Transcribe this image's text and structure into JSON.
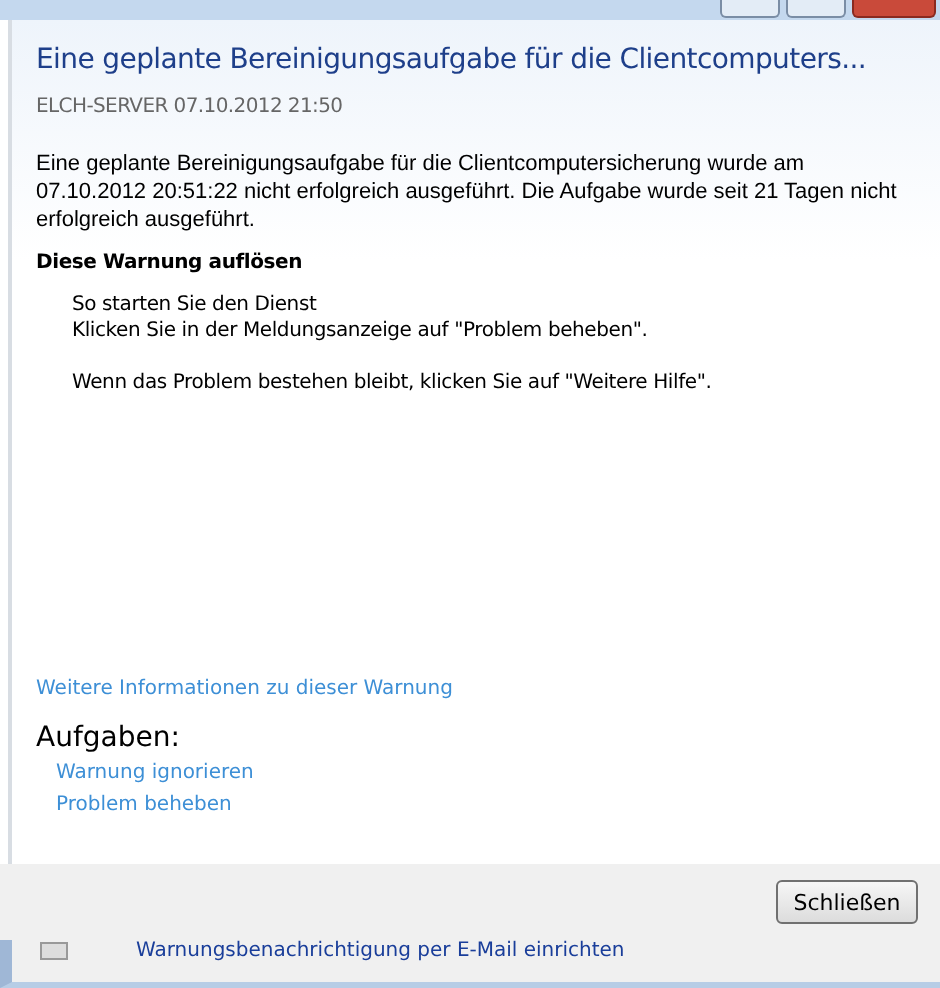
{
  "title": "Eine geplante Bereinigungsaufgabe für die Clientcomputers...",
  "source": "ELCH-SERVER 07.10.2012 21:50",
  "description": "Eine geplante Bereinigungsaufgabe für die Clientcomputersicherung wurde am 07.10.2012 20:51:22 nicht erfolgreich ausgeführt. Die Aufgabe wurde seit 21 Tagen nicht erfolgreich ausgeführt.",
  "resolve_heading": "Diese Warnung auflösen",
  "resolve_paragraphs": [
    [
      "So starten Sie den Dienst",
      "Klicken Sie in der Meldungsanzeige auf \"Problem beheben\"."
    ],
    [
      "Wenn das Problem bestehen bleibt, klicken Sie auf \"Weitere Hilfe\"."
    ]
  ],
  "more_info_link": "Weitere Informationen zu dieser Warnung",
  "tasks_heading": "Aufgaben:",
  "tasks": [
    "Warnung ignorieren",
    "Problem beheben"
  ],
  "buttons": [
    "Schließen"
  ],
  "background_link": "Warnungsbenachrichtigung per E-Mail einrichten"
}
